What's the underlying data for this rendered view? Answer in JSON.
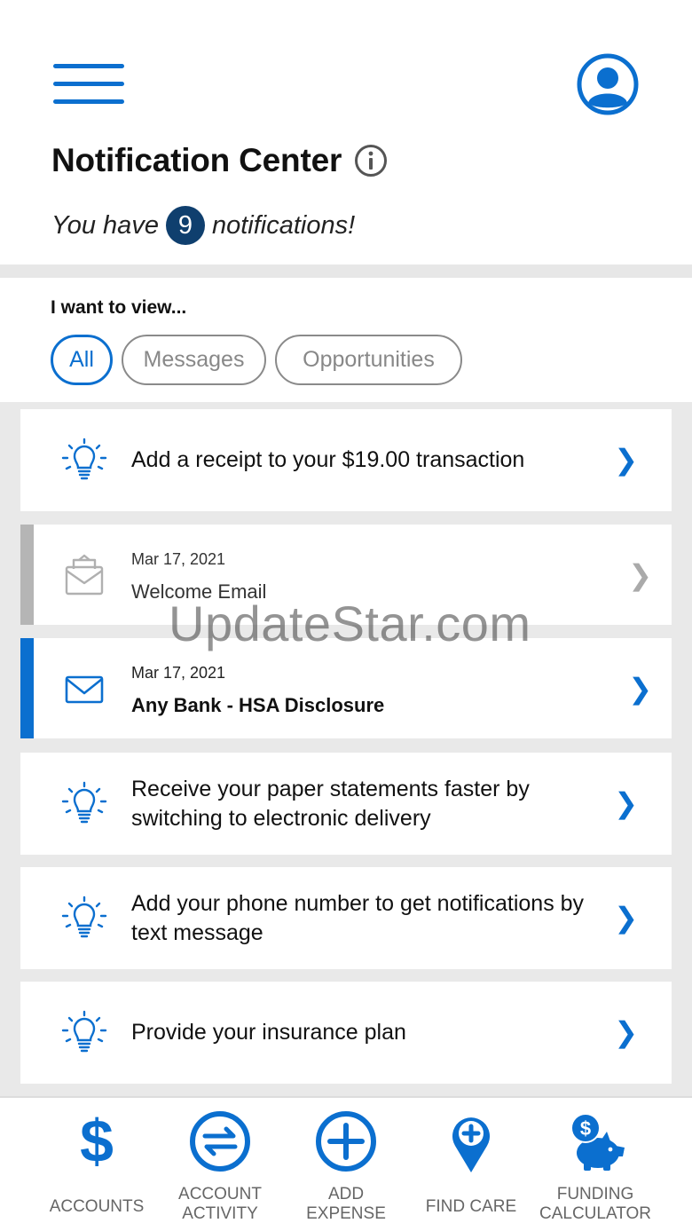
{
  "header": {
    "title": "Notification Center",
    "count_prefix": "You have",
    "count": "9",
    "count_suffix": "notifications!"
  },
  "filter": {
    "label": "I want to view...",
    "options": [
      "All",
      "Messages",
      "Opportunities"
    ],
    "selected": "All"
  },
  "notifications": [
    {
      "type": "opportunity",
      "icon": "lightbulb-icon",
      "text": "Add a receipt to your $19.00 transaction"
    },
    {
      "type": "message",
      "status": "read",
      "icon": "envelope-open-icon",
      "date": "Mar 17, 2021",
      "title": "Welcome Email"
    },
    {
      "type": "message",
      "status": "unread",
      "icon": "envelope-icon",
      "date": "Mar 17, 2021",
      "title": "Any Bank - HSA Disclosure"
    },
    {
      "type": "opportunity",
      "icon": "lightbulb-icon",
      "text_line1": "Receive your paper statements faster by",
      "text_line2": "switching to electronic delivery"
    },
    {
      "type": "opportunity",
      "icon": "lightbulb-icon",
      "text_line1": "Add your phone number to get notifications by",
      "text_line2": "text message"
    },
    {
      "type": "opportunity",
      "icon": "lightbulb-icon",
      "text": "Provide your insurance plan"
    }
  ],
  "chevron": "❯",
  "bottom_nav": [
    {
      "label_line1": "ACCOUNTS",
      "label_line2": "",
      "icon": "dollar-icon"
    },
    {
      "label_line1": "ACCOUNT",
      "label_line2": "ACTIVITY",
      "icon": "transfer-arrows-icon"
    },
    {
      "label_line1": "ADD",
      "label_line2": "EXPENSE",
      "icon": "plus-circle-icon"
    },
    {
      "label_line1": "FIND CARE",
      "label_line2": "",
      "icon": "map-pin-plus-icon"
    },
    {
      "label_line1": "FUNDING",
      "label_line2": "CALCULATOR",
      "icon": "piggy-bank-icon"
    }
  ],
  "watermark": "UpdateStar.com",
  "colors": {
    "accent": "#0b6fcf",
    "badge": "#0f3f6e",
    "read_bar": "#b5b5b5",
    "background_gray": "#e9e9e9"
  }
}
